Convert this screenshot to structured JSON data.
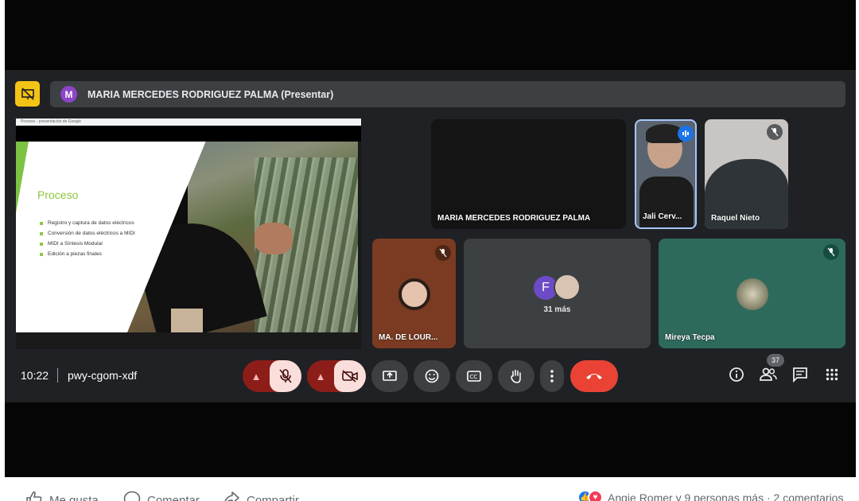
{
  "meet": {
    "presenter_initial": "M",
    "presenter_bar": "MARIA MERCEDES RODRIGUEZ PALMA (Presentar)",
    "screen_tab": "Proceso - presentación de Google",
    "slide": {
      "title": "Proceso",
      "bullets": [
        "Registro y captura de datos eléctricos",
        "Conversión de datos eléctricos a MIDI",
        "MIDI a Síntesis Modular",
        "Edición a piezas finales"
      ]
    },
    "tiles": {
      "maria": "MARIA MERCEDES RODRIGUEZ PALMA",
      "jali": "Jali Cerv...",
      "raquel": "Raquel Nieto",
      "ma_lour": "MA. DE LOUR...",
      "more_initial": "F",
      "more_count": "31 más",
      "mireya": "Mireya Tecpa"
    },
    "time": "10:22",
    "code": "pwy-cgom-xdf",
    "participants_badge": "37"
  },
  "colors": {
    "accent_yellow": "#f3c316",
    "end_call": "#ea4335",
    "mic_off_bg": "#f9dedc",
    "slide_green": "#8ec641"
  },
  "facebook": {
    "like": "Me gusta",
    "comment": "Comentar",
    "share": "Compartir",
    "reactions_summary": "Angie Romer y 9 personas más · 2 comentarios"
  }
}
